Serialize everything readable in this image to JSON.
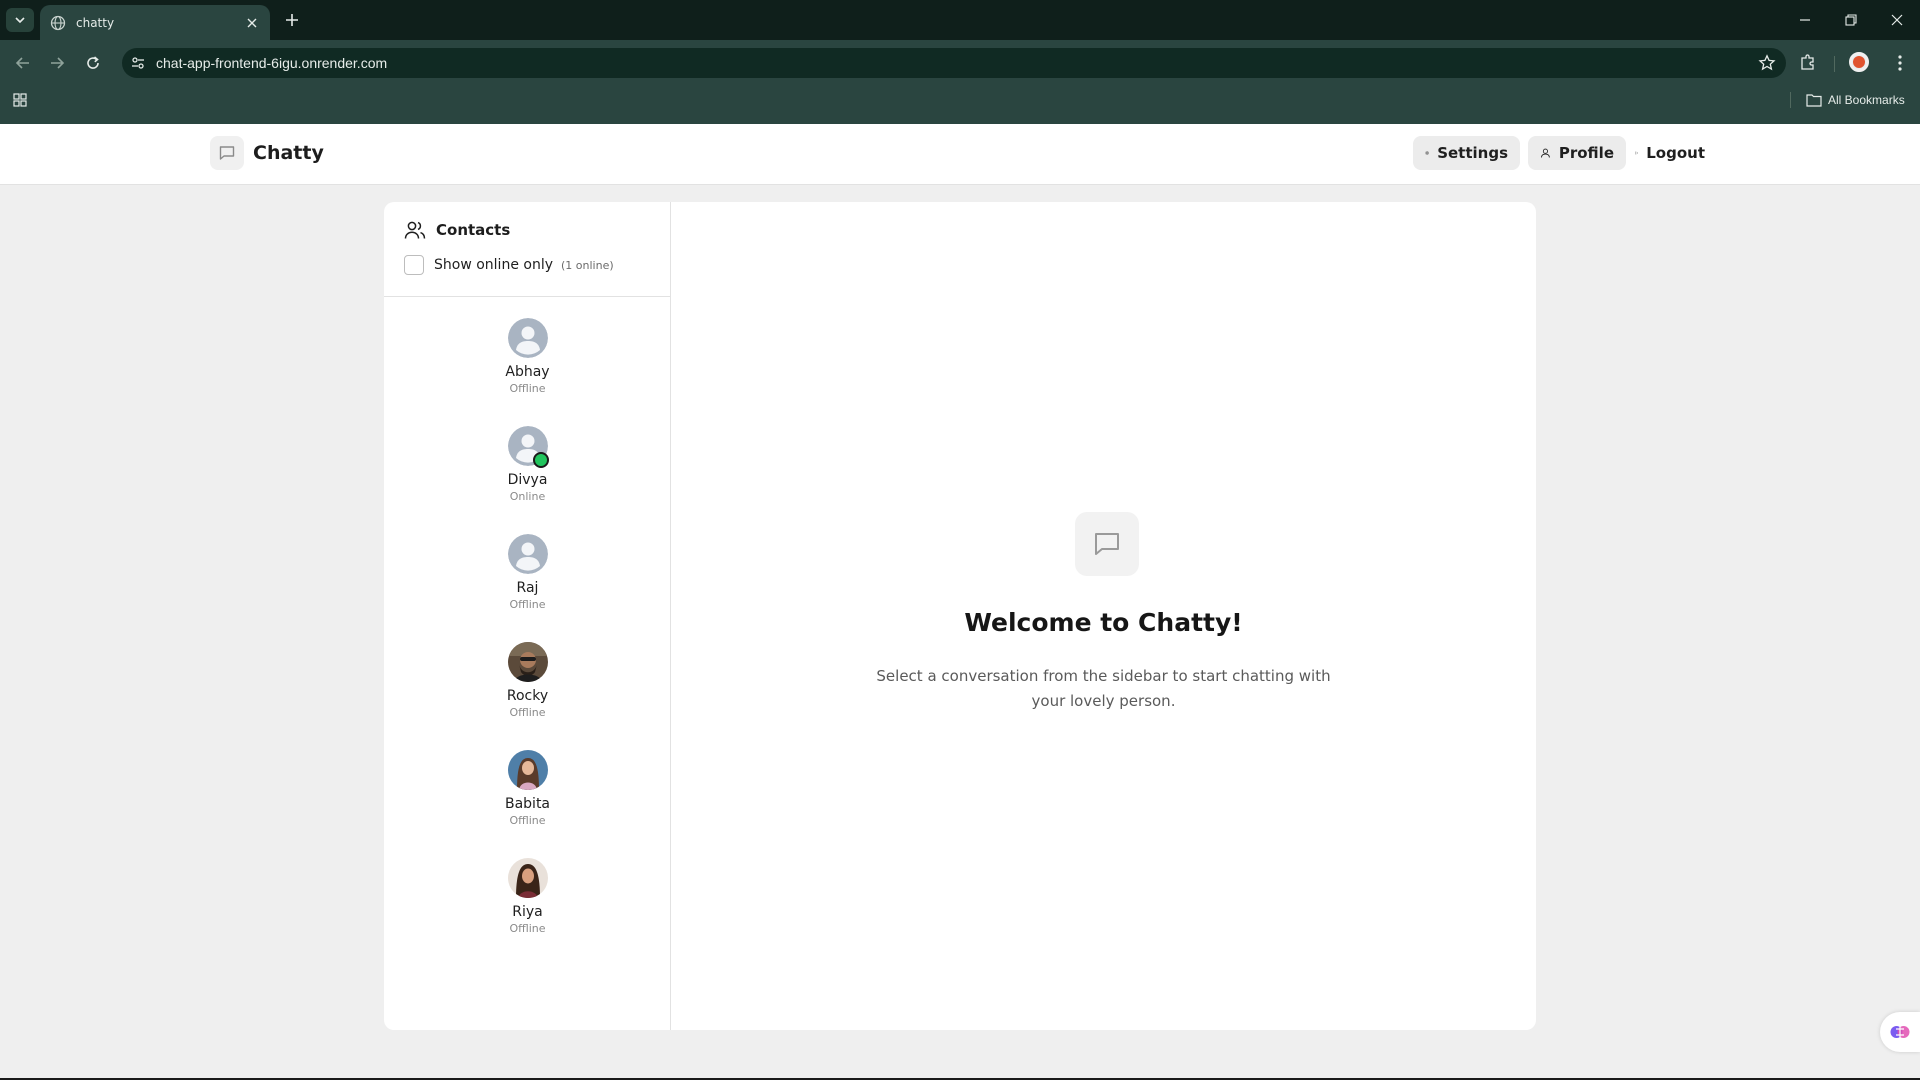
{
  "browser": {
    "tab_title": "chatty",
    "url": "chat-app-frontend-6igu.onrender.com",
    "bookmarks_label": "All Bookmarks"
  },
  "header": {
    "brand": "Chatty",
    "settings_label": "Settings",
    "profile_label": "Profile",
    "logout_label": "Logout"
  },
  "sidebar": {
    "title": "Contacts",
    "filter_label": "Show online only",
    "online_count": "(1 online)",
    "contacts": [
      {
        "name": "Abhay",
        "status": "Offline",
        "avatar": "default-avatar"
      },
      {
        "name": "Divya",
        "status": "Online",
        "avatar": "default-avatar"
      },
      {
        "name": "Raj",
        "status": "Offline",
        "avatar": "default-avatar"
      },
      {
        "name": "Rocky",
        "status": "Offline",
        "avatar": "photo"
      },
      {
        "name": "Babita",
        "status": "Offline",
        "avatar": "photo"
      },
      {
        "name": "Riya",
        "status": "Offline",
        "avatar": "photo"
      }
    ]
  },
  "welcome": {
    "title": "Welcome to Chatty!",
    "subtitle": "Select a conversation from the sidebar to start chatting with your lovely person."
  },
  "colors": {
    "online_dot": "#22c55e",
    "browser_frame": "#0f1f1b",
    "browser_toolbar": "#2a4540"
  }
}
